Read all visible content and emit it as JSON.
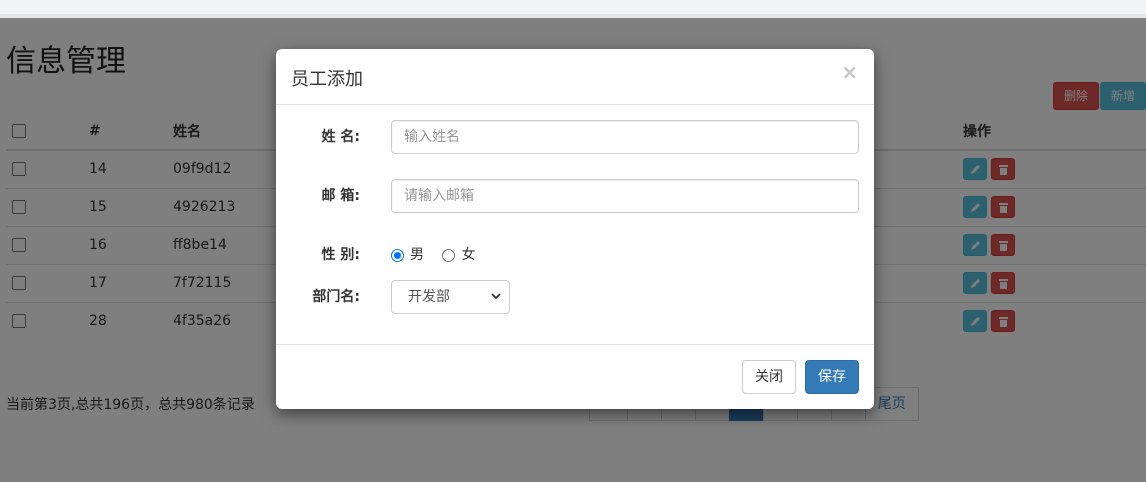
{
  "page": {
    "title": "信息管理",
    "delete_label": "删除",
    "add_label": "新增"
  },
  "table": {
    "headers": {
      "id": "#",
      "name": "姓名",
      "op": "操作"
    },
    "rows": [
      {
        "id": "14",
        "name": "09f9d12"
      },
      {
        "id": "15",
        "name": "4926213"
      },
      {
        "id": "16",
        "name": "ff8be14"
      },
      {
        "id": "17",
        "name": "7f72115"
      },
      {
        "id": "28",
        "name": "4f35a26"
      }
    ]
  },
  "pager": {
    "info": "当前第3页,总共196页，总共980条记录",
    "last_label": "尾页"
  },
  "modal": {
    "title": "员工添加",
    "close_glyph": "×",
    "name_label": "姓 名:",
    "name_placeholder": "输入姓名",
    "email_label": "邮 箱:",
    "email_placeholder": "请输入邮箱",
    "gender_label": "性 别:",
    "gender_male": "男",
    "gender_female": "女",
    "dept_label": "部门名:",
    "dept_selected": "开发部",
    "close_button": "关闭",
    "save_button": "保存"
  },
  "icons": {
    "edit": "pencil-icon",
    "delete": "trash-icon"
  },
  "colors": {
    "primary": "#337ab7",
    "danger": "#d9534f",
    "info": "#5bc0de"
  }
}
